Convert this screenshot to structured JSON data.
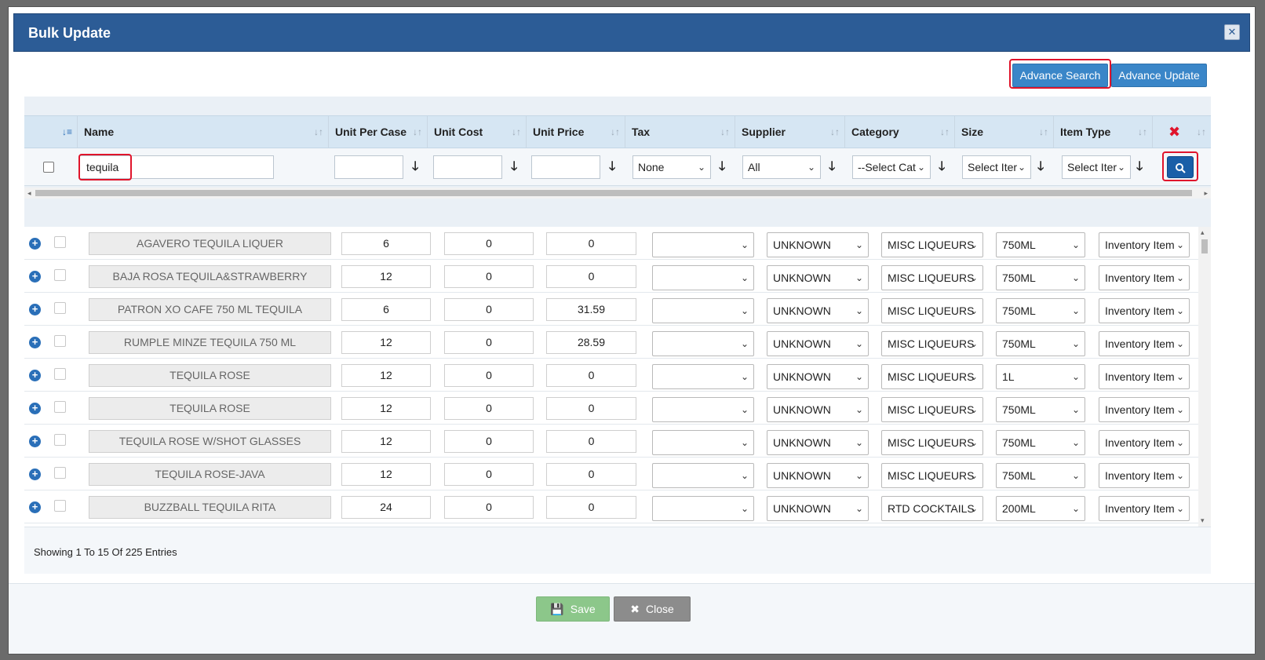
{
  "modal": {
    "title": "Bulk Update",
    "close_icon": "close-icon"
  },
  "toolbar": {
    "advance_search_label": "Advance Search",
    "advance_update_label": "Advance Update"
  },
  "columns": {
    "name": "Name",
    "unit_per_case": "Unit Per Case",
    "unit_cost": "Unit Cost",
    "unit_price": "Unit Price",
    "tax": "Tax",
    "supplier": "Supplier",
    "category": "Category",
    "size": "Size",
    "item_type": "Item Type"
  },
  "filters": {
    "name_value": "tequila",
    "tax_value": "None",
    "supplier_value": "All",
    "category_value": "--Select Cat",
    "size_value": "Select Iter",
    "item_type_value": "Select Iter"
  },
  "rows": [
    {
      "name": "AGAVERO TEQUILA LIQUER",
      "upc": "6",
      "cost": "0",
      "price": "0",
      "tax": "",
      "supplier": "UNKNOWN",
      "category": "MISC LIQUEURS",
      "size": "750ML",
      "item_type": "Inventory Item"
    },
    {
      "name": "BAJA ROSA TEQUILA&STRAWBERRY",
      "upc": "12",
      "cost": "0",
      "price": "0",
      "tax": "",
      "supplier": "UNKNOWN",
      "category": "MISC LIQUEURS",
      "size": "750ML",
      "item_type": "Inventory Item"
    },
    {
      "name": "PATRON XO CAFE 750 ML TEQUILA",
      "upc": "6",
      "cost": "0",
      "price": "31.59",
      "tax": "",
      "supplier": "UNKNOWN",
      "category": "MISC LIQUEURS",
      "size": "750ML",
      "item_type": "Inventory Item"
    },
    {
      "name": "RUMPLE MINZE TEQUILA 750 ML",
      "upc": "12",
      "cost": "0",
      "price": "28.59",
      "tax": "",
      "supplier": "UNKNOWN",
      "category": "MISC LIQUEURS",
      "size": "750ML",
      "item_type": "Inventory Item"
    },
    {
      "name": "TEQUILA ROSE",
      "upc": "12",
      "cost": "0",
      "price": "0",
      "tax": "",
      "supplier": "UNKNOWN",
      "category": "MISC LIQUEURS",
      "size": "1L",
      "item_type": "Inventory Item"
    },
    {
      "name": "TEQUILA ROSE",
      "upc": "12",
      "cost": "0",
      "price": "0",
      "tax": "",
      "supplier": "UNKNOWN",
      "category": "MISC LIQUEURS",
      "size": "750ML",
      "item_type": "Inventory Item"
    },
    {
      "name": "TEQUILA ROSE W/SHOT GLASSES",
      "upc": "12",
      "cost": "0",
      "price": "0",
      "tax": "",
      "supplier": "UNKNOWN",
      "category": "MISC LIQUEURS",
      "size": "750ML",
      "item_type": "Inventory Item"
    },
    {
      "name": "TEQUILA ROSE-JAVA",
      "upc": "12",
      "cost": "0",
      "price": "0",
      "tax": "",
      "supplier": "UNKNOWN",
      "category": "MISC LIQUEURS",
      "size": "750ML",
      "item_type": "Inventory Item"
    },
    {
      "name": "BUZZBALL TEQUILA RITA",
      "upc": "24",
      "cost": "0",
      "price": "0",
      "tax": "",
      "supplier": "UNKNOWN",
      "category": "RTD COCKTAILS",
      "size": "200ML",
      "item_type": "Inventory Item"
    },
    {
      "name": "",
      "upc": "",
      "cost": "",
      "price": "",
      "tax": "",
      "supplier": "",
      "category": "",
      "size": "",
      "item_type": ""
    }
  ],
  "footer": {
    "entries_text": "Showing 1 To 15 Of 225 Entries",
    "save_label": "Save",
    "close_label": "Close"
  },
  "colors": {
    "header_blue": "#2c5c96",
    "button_blue": "#3a86c8",
    "highlight_red": "#e0142b",
    "save_green": "#8cc78a",
    "close_gray": "#8c8c8c"
  }
}
